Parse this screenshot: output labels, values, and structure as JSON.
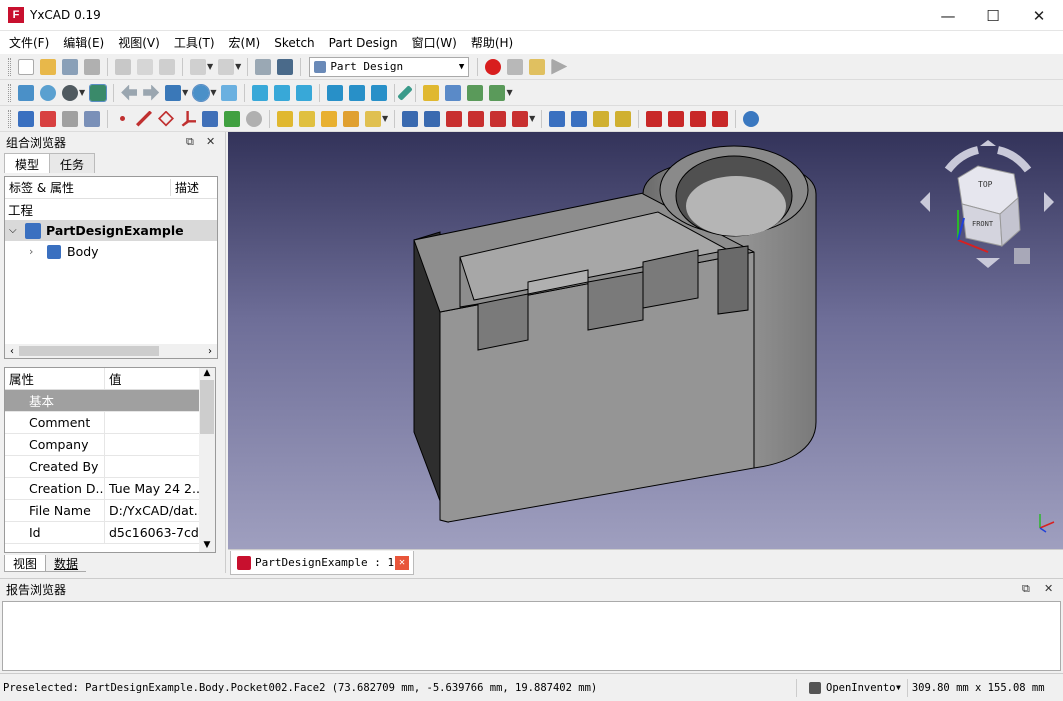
{
  "window": {
    "title": "YxCAD 0.19",
    "logo_text": "F"
  },
  "menu": [
    "文件(F)",
    "编辑(E)",
    "视图(V)",
    "工具(T)",
    "宏(M)",
    "Sketch",
    "Part Design",
    "窗口(W)",
    "帮助(H)"
  ],
  "toolbar": {
    "workbench_selected": "Part Design"
  },
  "combo_view": {
    "title": "组合浏览器",
    "tabs": [
      "模型",
      "任务"
    ],
    "tree_headers": {
      "label": "标签 & 属性",
      "description": "描述"
    },
    "tree_section": "工程",
    "tree_items": [
      {
        "label": "PartDesignExample",
        "bold": true
      },
      {
        "label": "Body",
        "bold": false
      }
    ],
    "property_headers": {
      "name": "属性",
      "value": "值"
    },
    "property_group": "基本",
    "properties": [
      {
        "name": "Comment",
        "value": ""
      },
      {
        "name": "Company",
        "value": ""
      },
      {
        "name": "Created By",
        "value": ""
      },
      {
        "name": "Creation D...",
        "value": "Tue May 24 2..."
      },
      {
        "name": "File Name",
        "value": "D:/YxCAD/dat..."
      },
      {
        "name": "Id",
        "value": "d5c16063-7cd..."
      }
    ],
    "bottom_tabs": [
      "视图",
      "数据"
    ]
  },
  "navcube": {
    "top_face": "TOP",
    "front_face": "FRONT"
  },
  "document_tab": {
    "label": "PartDesignExample : 1"
  },
  "report_view": {
    "title": "报告浏览器"
  },
  "status": {
    "preselection": "Preselected: PartDesignExample.Body.Pocket002.Face2 (73.682709 mm, -5.639766 mm, 19.887402 mm)",
    "navigation_style": "OpenInvento",
    "dimensions": "309.80 mm x 155.08 mm"
  },
  "colors": {
    "accent": "#0078d7",
    "record": "#d81e1e",
    "viewport_top": "#33335a",
    "viewport_bottom": "#9f9fbf"
  }
}
